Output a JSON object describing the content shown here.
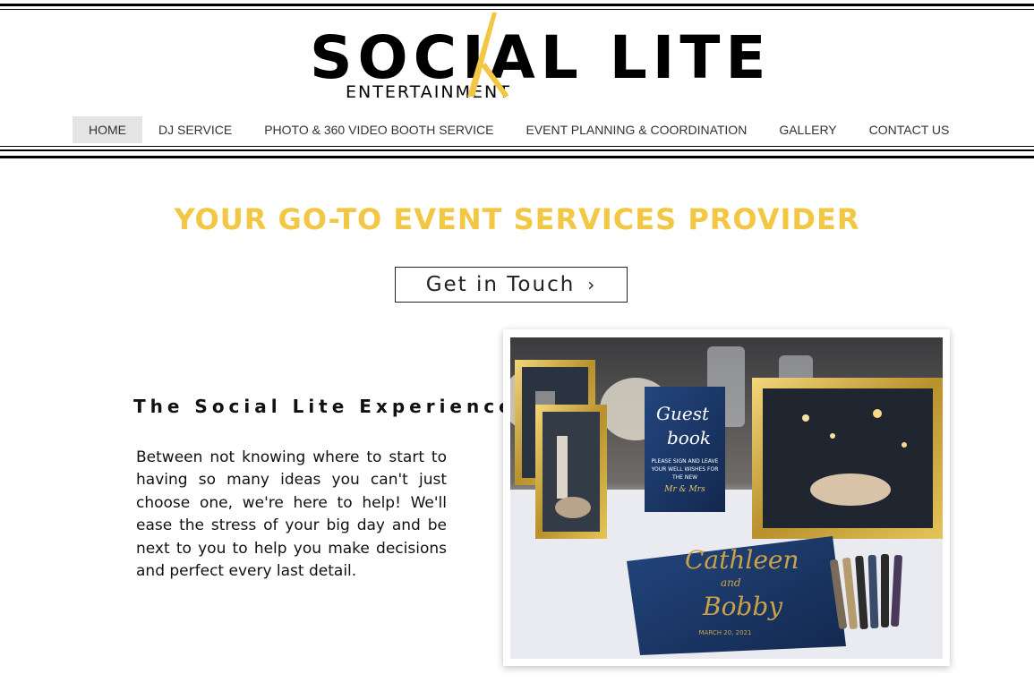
{
  "logo": {
    "wordmark": "SOCIAL LITE",
    "subtitle": "ENTERTAINMENT",
    "accent_color": "#f2c744"
  },
  "nav": {
    "items": [
      {
        "label": "HOME",
        "active": true
      },
      {
        "label": "DJ SERVICE"
      },
      {
        "label": "PHOTO & 360 VIDEO BOOTH SERVICE"
      },
      {
        "label": "EVENT PLANNING & COORDINATION"
      },
      {
        "label": "GALLERY"
      },
      {
        "label": "CONTACT US"
      }
    ]
  },
  "hero": {
    "headline": "YOUR GO-TO EVENT SERVICES PROVIDER",
    "headline_color": "#f2c744"
  },
  "cta": {
    "label": "Get in Touch",
    "icon": "chevron-right-icon"
  },
  "experience": {
    "title": "The Social Lite Experience",
    "body": "Between not knowing where to start to having so many ideas you can't just choose one, we're here to help! We'll ease the stress of your big day and be next to you to help you make decisions and perfect every last detail."
  },
  "photo": {
    "sign_title": "Guest book",
    "sign_text": "PLEASE SIGN AND LEAVE YOUR WELL WISHES FOR THE NEW",
    "sign_names": "Mr & Mrs",
    "book_names": "Cathleen and Bobby",
    "book_date": "MARCH 20, 2021"
  }
}
